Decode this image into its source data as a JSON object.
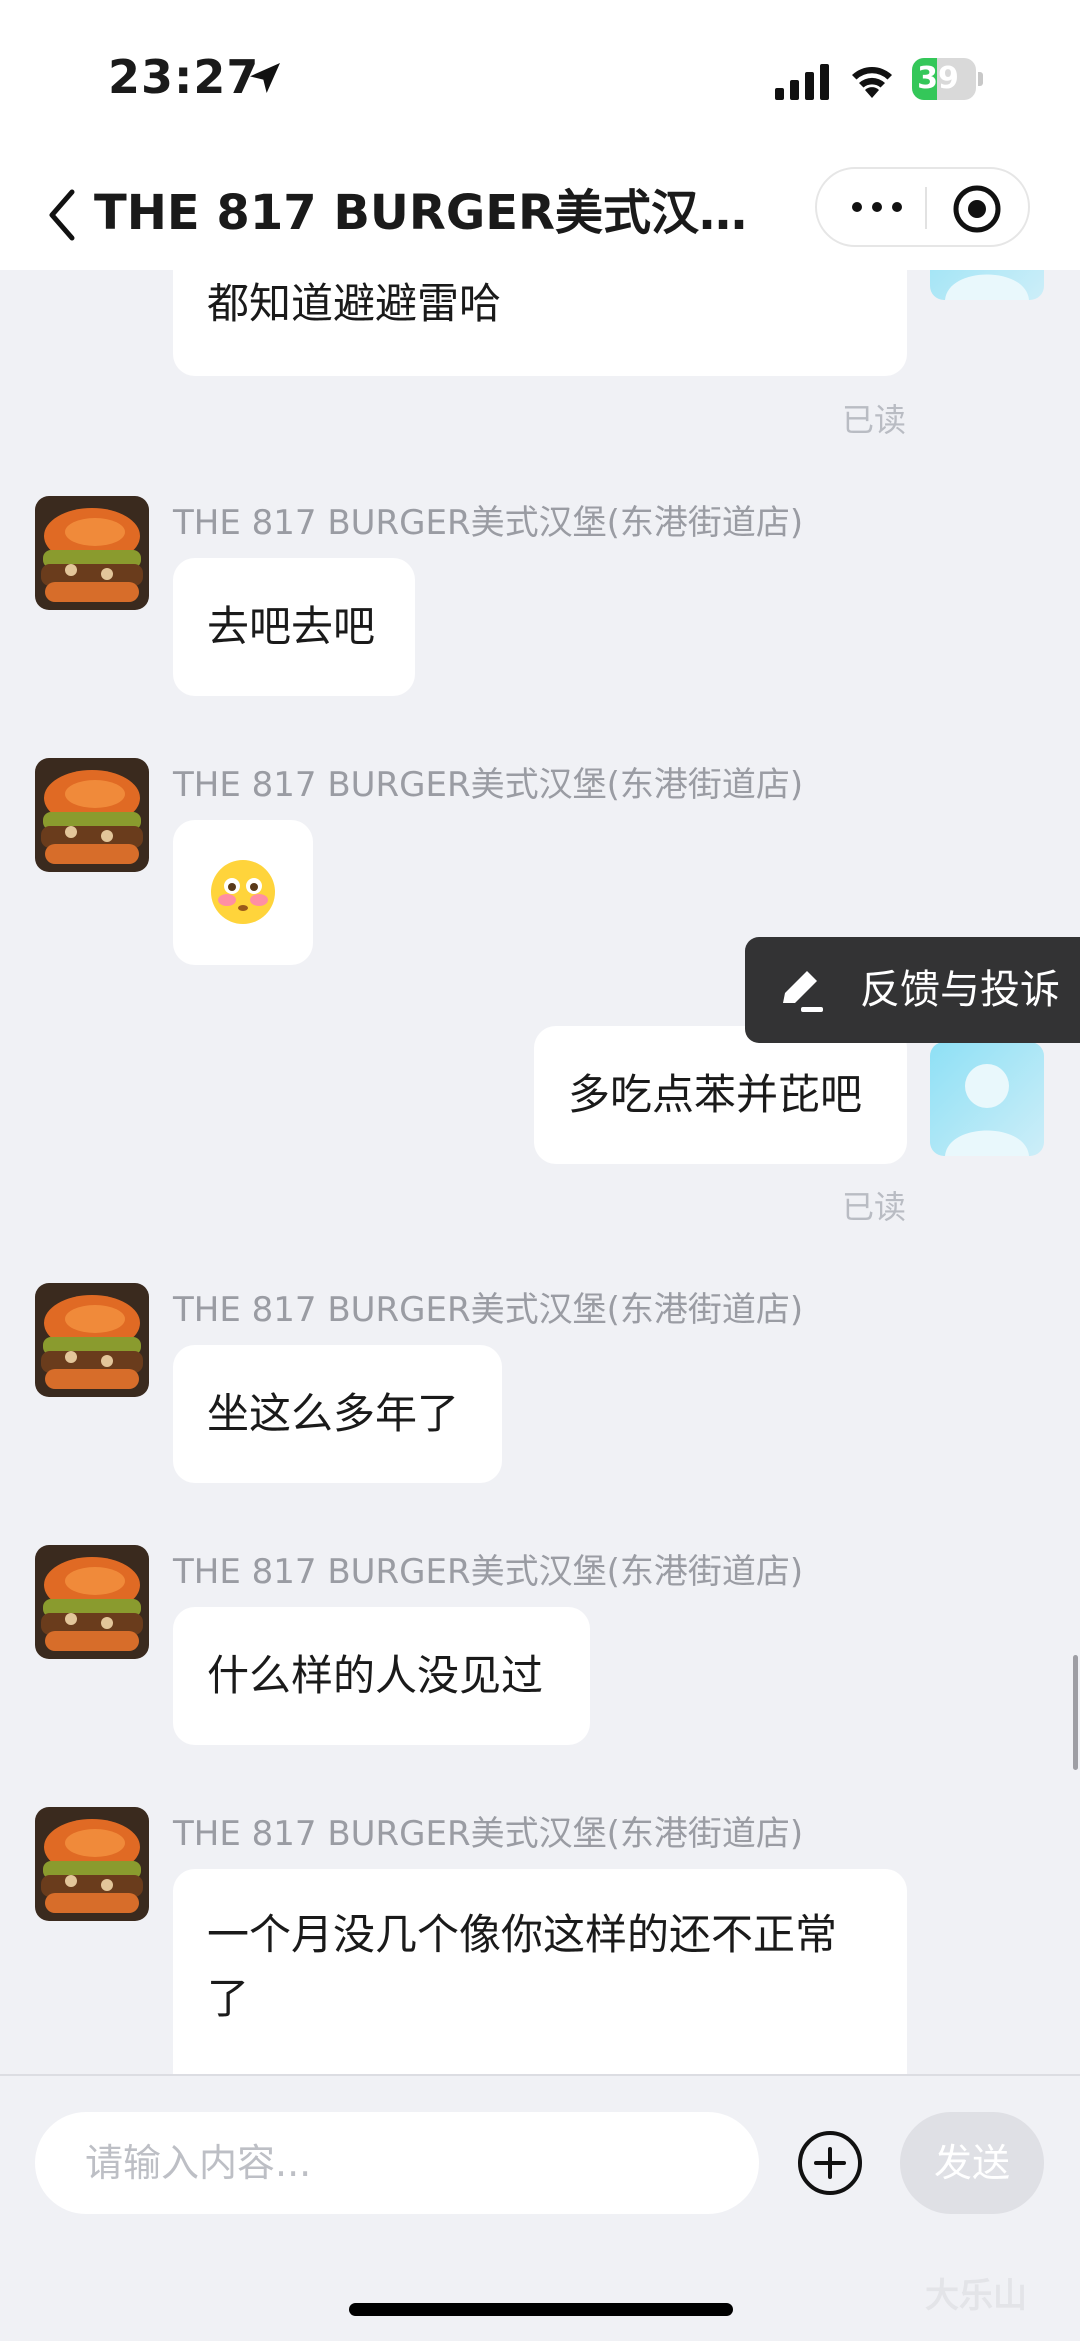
{
  "status_bar": {
    "time": "23:27",
    "battery": "39",
    "battery_level": 0.39,
    "battery_color": "#34c759",
    "icons": [
      "location-arrow-icon",
      "signal-icon",
      "wifi-icon",
      "battery-icon"
    ]
  },
  "nav": {
    "title": "THE 817 BURGER美式汉…",
    "icons": [
      "back-icon",
      "more-icon",
      "target-icon"
    ]
  },
  "messages": [
    {
      "side": "user",
      "text": "都知道避避雷哈"
    },
    {
      "read": "已读"
    },
    {
      "side": "shop",
      "sender": "THE 817 BURGER美式汉堡(东港街道店)",
      "text": "去吧去吧"
    },
    {
      "side": "shop",
      "sender": "THE 817 BURGER美式汉堡(东港街道店)",
      "emoji": "😳"
    },
    {
      "side": "user",
      "text": "多吃点苯并芘吧"
    },
    {
      "read": "已读"
    },
    {
      "side": "shop",
      "sender": "THE 817 BURGER美式汉堡(东港街道店)",
      "text": "坐这么多年了"
    },
    {
      "side": "shop",
      "sender": "THE 817 BURGER美式汉堡(东港街道店)",
      "text": "什么样的人没见过"
    },
    {
      "side": "shop",
      "sender": "THE 817 BURGER美式汉堡(东港街道店)",
      "text_lines": [
        "一个月没几个像你这样的还不正常",
        "了"
      ]
    }
  ],
  "feedback": {
    "label": "反馈与投诉",
    "icon": "edit-pen-icon"
  },
  "input": {
    "placeholder": "请输入内容...",
    "send_label": "发送",
    "plus_icon": "plus-circle-icon"
  },
  "watermark": "大乐山"
}
